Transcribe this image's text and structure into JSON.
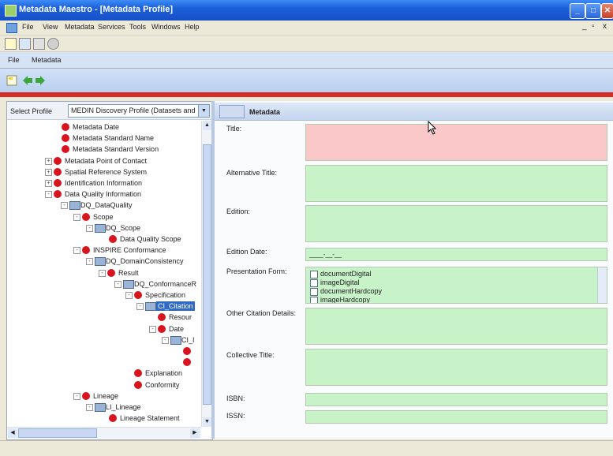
{
  "window": {
    "title": "Metadata Maestro - [Metadata Profile]",
    "buttons": [
      "_",
      "□",
      "✕"
    ]
  },
  "menubar": {
    "items": [
      "File",
      "View",
      "Metadata",
      "Services",
      "Tools",
      "Windows",
      "Help"
    ],
    "mdi_controls": [
      "_",
      "▫",
      "x"
    ]
  },
  "inner_menu": {
    "items": [
      "File",
      "Metadata"
    ]
  },
  "select_profile": {
    "label": "Select Profile",
    "value": "MEDIN Discovery Profile (Datasets and"
  },
  "tree": [
    {
      "label": "Metadata Date",
      "icon": "dot",
      "exp": ""
    },
    {
      "label": "Metadata Standard Name",
      "icon": "dot",
      "exp": ""
    },
    {
      "label": "Metadata Standard Version",
      "icon": "dot",
      "exp": ""
    },
    {
      "label": "Metadata Point of Contact",
      "icon": "dot",
      "exp": "+"
    },
    {
      "label": "Spatial Reference System",
      "icon": "dot",
      "exp": "+"
    },
    {
      "label": "Identification Information",
      "icon": "dot",
      "exp": "+"
    },
    {
      "label": "Data Quality Information",
      "icon": "dot",
      "exp": "-"
    },
    {
      "label": "DQ_DataQuality",
      "icon": "folder",
      "exp": "-"
    },
    {
      "label": "Scope",
      "icon": "dot",
      "exp": "-"
    },
    {
      "label": "DQ_Scope",
      "icon": "folder",
      "exp": "-"
    },
    {
      "label": "Data Quality Scope",
      "icon": "dot",
      "exp": ""
    },
    {
      "label": "INSPIRE Conformance",
      "icon": "dot",
      "exp": "-"
    },
    {
      "label": "DQ_DomainConsistency",
      "icon": "folder",
      "exp": "-"
    },
    {
      "label": "Result",
      "icon": "dot",
      "exp": "-"
    },
    {
      "label": "DQ_ConformanceR",
      "icon": "folder",
      "exp": "-"
    },
    {
      "label": "Specification",
      "icon": "dot",
      "exp": "-"
    },
    {
      "label": "CI_Citation",
      "icon": "folder",
      "exp": "-",
      "selected": true
    },
    {
      "label": "Resour",
      "icon": "dot",
      "exp": ""
    },
    {
      "label": "Date",
      "icon": "dot",
      "exp": "-"
    },
    {
      "label": "CI_I",
      "icon": "folder",
      "exp": "-"
    },
    {
      "label": "",
      "icon": "dot",
      "exp": ""
    },
    {
      "label": "",
      "icon": "dot",
      "exp": ""
    },
    {
      "label": "Explanation",
      "icon": "dot",
      "exp": ""
    },
    {
      "label": "Conformity",
      "icon": "dot",
      "exp": ""
    },
    {
      "label": "Lineage",
      "icon": "dot",
      "exp": "-"
    },
    {
      "label": "LI_Lineage",
      "icon": "folder",
      "exp": "-"
    },
    {
      "label": "Lineage Statement",
      "icon": "dot",
      "exp": ""
    }
  ],
  "metadata_panel": {
    "header": "Metadata",
    "fields": {
      "title": {
        "label": "Title:",
        "value": ""
      },
      "alt_title": {
        "label": "Alternative Title:",
        "value": ""
      },
      "edition": {
        "label": "Edition:",
        "value": ""
      },
      "edition_date": {
        "label": "Edition Date:",
        "value": "____-__-__"
      },
      "presentation_form": {
        "label": "Presentation Form:",
        "options": [
          "documentDigital",
          "imageDigital",
          "documentHardcopy",
          "imageHardcopy"
        ],
        "selected": "documentHardcopy"
      },
      "other_citation": {
        "label": "Other Citation Details:",
        "value": ""
      },
      "collective_title": {
        "label": "Collective Title:",
        "value": ""
      },
      "isbn": {
        "label": "ISBN:",
        "value": ""
      },
      "issn": {
        "label": "ISSN:",
        "value": ""
      }
    }
  },
  "colors": {
    "titlebar": "#1c5fd8",
    "required_field": "#fac8c8",
    "filled_field": "#c8f2c8",
    "tree_required_dot": "#d8141e",
    "red_bar": "#d52c26"
  }
}
